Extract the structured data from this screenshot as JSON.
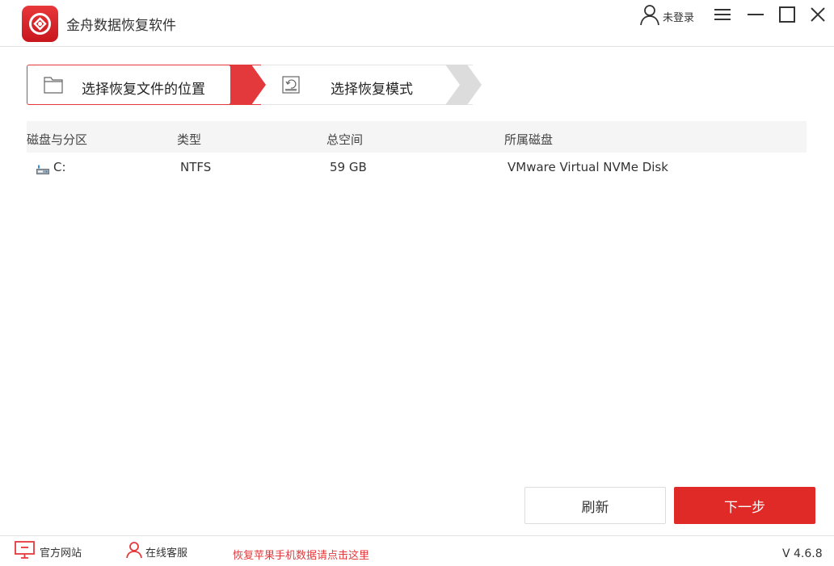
{
  "app": {
    "title": "金舟数据恢复软件"
  },
  "header": {
    "user_label": "未登录"
  },
  "steps": [
    {
      "label": "选择恢复文件的位置"
    },
    {
      "label": "选择恢复模式"
    }
  ],
  "table": {
    "columns": [
      "磁盘与分区",
      "类型",
      "总空间",
      "所属磁盘"
    ],
    "rows": [
      {
        "partition": "C:",
        "type": "NTFS",
        "size": "59 GB",
        "disk": "VMware Virtual NVMe Disk"
      }
    ]
  },
  "buttons": {
    "refresh": "刷新",
    "next": "下一步"
  },
  "footer": {
    "website": "官方网站",
    "support": "在线客服",
    "apple_link": "恢复苹果手机数据请点击这里",
    "version": "V 4.6.8"
  },
  "colors": {
    "accent": "#e02a28",
    "border_light": "#e4e4e4",
    "header_bg": "#f5f5f5"
  }
}
